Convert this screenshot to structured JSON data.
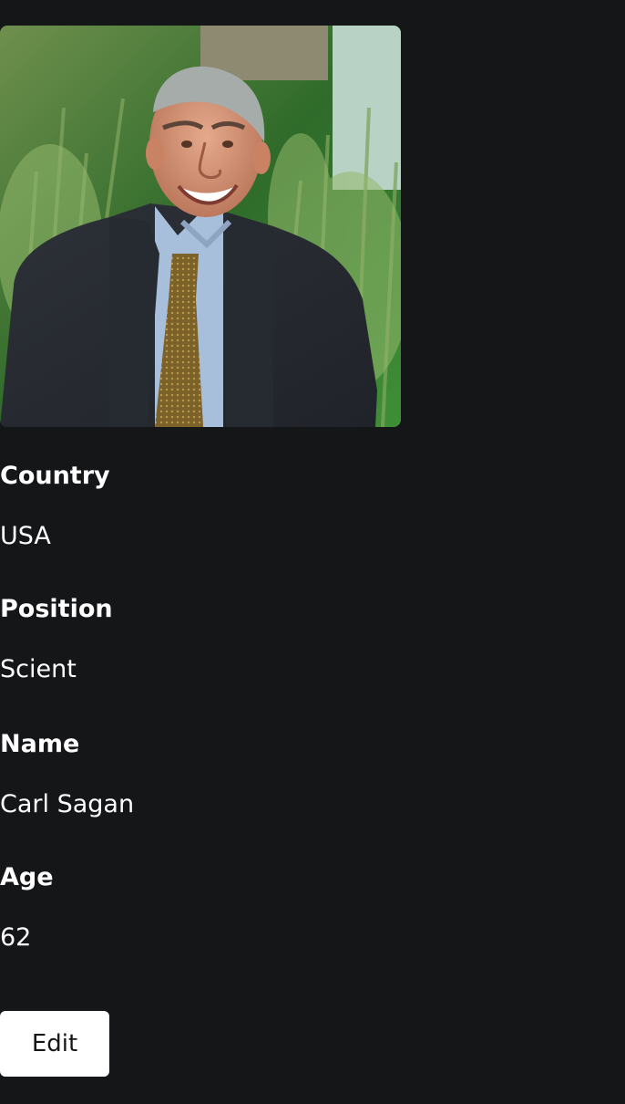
{
  "profile": {
    "photo": {
      "alt": "Carl Sagan",
      "icon": "portrait-photo"
    },
    "fields": [
      {
        "label": "Country",
        "value": "USA"
      },
      {
        "label": "Position",
        "value": "Scient"
      },
      {
        "label": "Name",
        "value": "Carl Sagan"
      },
      {
        "label": "Age",
        "value": "62"
      }
    ],
    "edit_label": "Edit"
  },
  "colors": {
    "background": "#151618",
    "text": "#ffffff",
    "button_background": "#ffffff",
    "button_text": "#151618"
  }
}
